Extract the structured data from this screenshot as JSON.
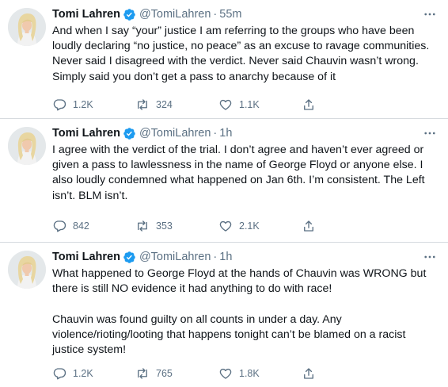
{
  "tweets": [
    {
      "name": "Tomi Lahren",
      "handle": "@TomiLahren",
      "time": "55m",
      "lines": [
        "And when I say “your” justice I am referring to the groups who have been",
        "loudly declaring “no justice, no peace” as an excuse to ravage communities.",
        "Never said I disagreed with the verdict. Never said Chauvin wasn’t wrong.",
        "Simply said you don’t get a pass to anarchy because of it"
      ],
      "replies": "1.2K",
      "retweets": "324",
      "likes": "1.1K"
    },
    {
      "name": "Tomi Lahren",
      "handle": "@TomiLahren",
      "time": "1h",
      "lines": [
        "I agree with the verdict of the trial. I don’t agree and haven’t ever agreed or",
        "given a pass to lawlessness in the name of George Floyd or anyone else. I",
        "also loudly condemned what happened on Jan 6th. I’m consistent. The Left",
        "isn’t. BLM isn’t."
      ],
      "replies": "842",
      "retweets": "353",
      "likes": "2.1K"
    },
    {
      "name": "Tomi Lahren",
      "handle": "@TomiLahren",
      "time": "1h",
      "lines": [
        "What happened to George Floyd at the hands of Chauvin was WRONG but",
        "there is still NO evidence it had anything to do with race!",
        "",
        "Chauvin was found guilty on all counts in under a day. Any",
        "violence/rioting/looting that happens tonight can’t be blamed on a racist",
        "justice system!"
      ],
      "replies": "1.2K",
      "retweets": "765",
      "likes": "1.8K"
    }
  ],
  "icons": {
    "verified": "verified-badge-icon",
    "more": "more-options-icon",
    "reply": "reply-icon",
    "retweet": "retweet-icon",
    "like": "like-icon",
    "share": "share-icon"
  },
  "colors": {
    "text": "#0f1419",
    "muted": "#5b7083",
    "verified": "#1d9bf0",
    "divider": "#d6dbdf"
  }
}
